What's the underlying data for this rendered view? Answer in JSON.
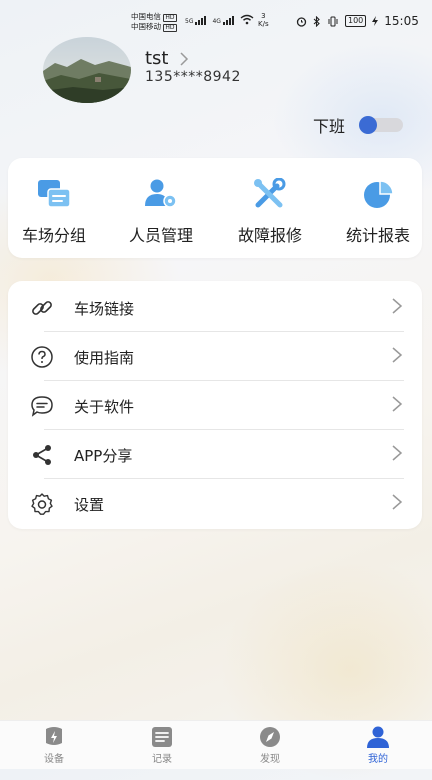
{
  "status_bar": {
    "carrier1": "中国电信",
    "carrier2": "中国移动",
    "hd": "HD",
    "net1": "5G",
    "net2": "4G",
    "speed_value": "3",
    "speed_unit": "K/s",
    "battery": "100",
    "time": "15:05"
  },
  "profile": {
    "username": "tst",
    "phone": "135****8942"
  },
  "duty": {
    "label": "下班",
    "toggle_on": true
  },
  "grid": [
    {
      "label": "车场分组",
      "icon": "parking-group-icon"
    },
    {
      "label": "人员管理",
      "icon": "user-management-icon"
    },
    {
      "label": "故障报修",
      "icon": "repair-tools-icon"
    },
    {
      "label": "统计报表",
      "icon": "pie-chart-icon"
    }
  ],
  "menu": [
    {
      "label": "车场链接",
      "icon": "link-icon"
    },
    {
      "label": "使用指南",
      "icon": "help-icon"
    },
    {
      "label": "关于软件",
      "icon": "chat-bubble-icon"
    },
    {
      "label": "APP分享",
      "icon": "share-icon"
    },
    {
      "label": "设置",
      "icon": "gear-icon"
    }
  ],
  "tabs": [
    {
      "label": "设备",
      "icon": "device-icon",
      "active": false
    },
    {
      "label": "记录",
      "icon": "record-icon",
      "active": false
    },
    {
      "label": "发现",
      "icon": "compass-icon",
      "active": false
    },
    {
      "label": "我的",
      "icon": "profile-icon",
      "active": true
    }
  ],
  "colors": {
    "accent": "#2f63d6",
    "icon_blue": "#3f8fe0",
    "toggle_knob": "#3b6bd4"
  }
}
